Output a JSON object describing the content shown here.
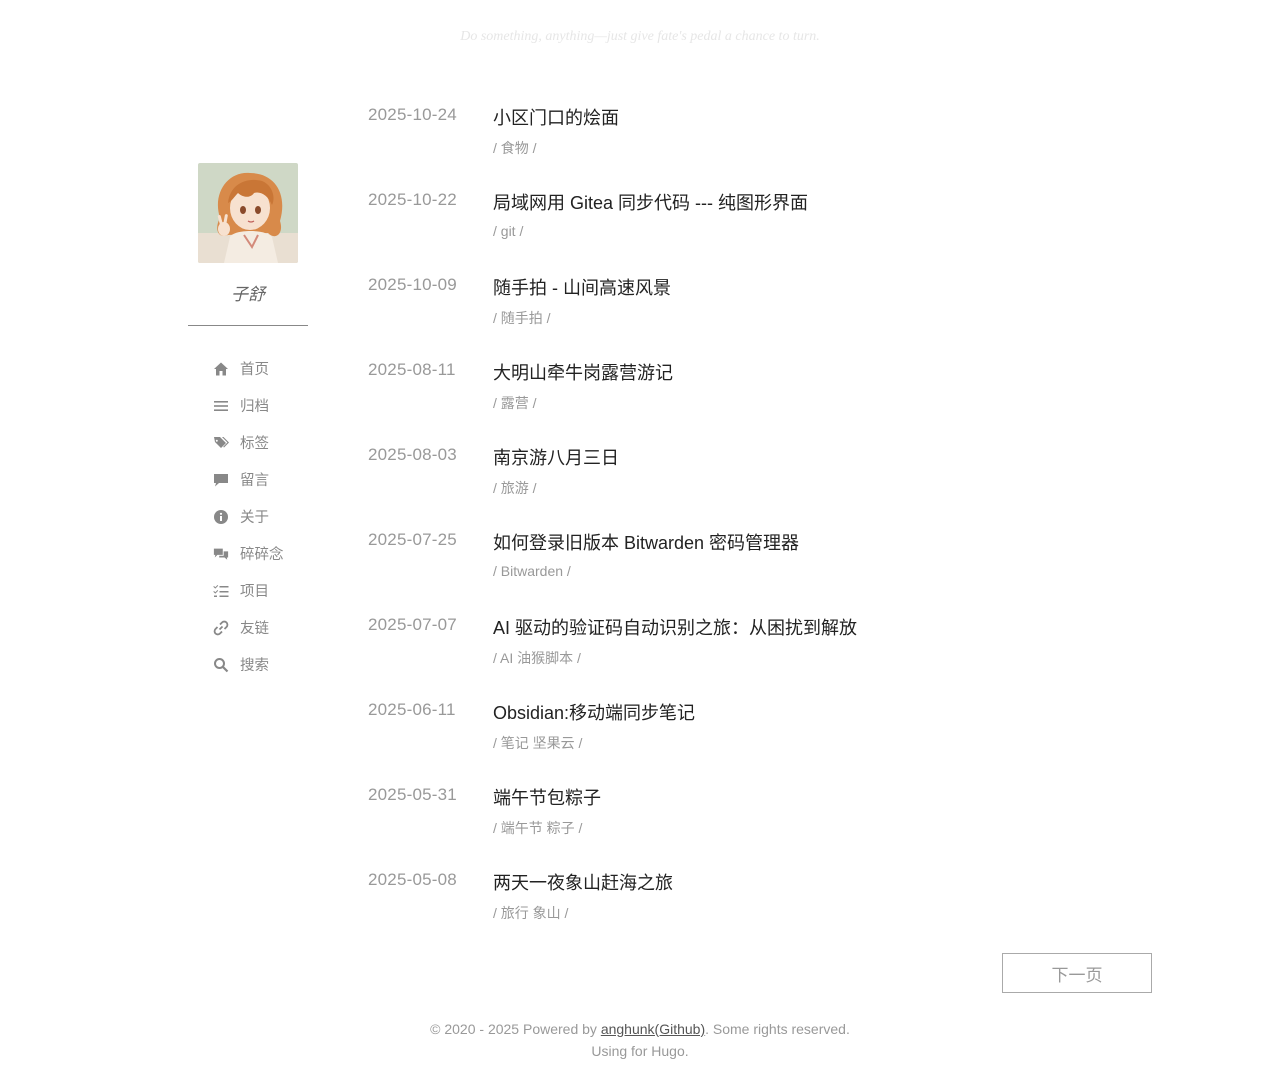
{
  "header": {
    "motto": "Do something, anything—just give fate's pedal a chance to turn."
  },
  "sidebar": {
    "author": "子舒",
    "avatar_icon": "anime-girl-avatar",
    "nav": [
      {
        "label": "首页",
        "icon": "home-icon"
      },
      {
        "label": "归档",
        "icon": "list-icon"
      },
      {
        "label": "标签",
        "icon": "tags-icon"
      },
      {
        "label": "留言",
        "icon": "comment-icon"
      },
      {
        "label": "关于",
        "icon": "info-icon"
      },
      {
        "label": "碎碎念",
        "icon": "comments-icon"
      },
      {
        "label": "项目",
        "icon": "tasks-icon"
      },
      {
        "label": "友链",
        "icon": "link-icon"
      },
      {
        "label": "搜索",
        "icon": "search-icon"
      }
    ]
  },
  "posts": [
    {
      "date": "2025-10-24",
      "title": "小区门口的烩面",
      "tags": [
        "食物"
      ]
    },
    {
      "date": "2025-10-22",
      "title": "局域网用 Gitea 同步代码 --- 纯图形界面",
      "tags": [
        "git"
      ]
    },
    {
      "date": "2025-10-09",
      "title": "随手拍 - 山间高速风景",
      "tags": [
        "随手拍"
      ]
    },
    {
      "date": "2025-08-11",
      "title": "大明山牵牛岗露营游记",
      "tags": [
        "露营"
      ]
    },
    {
      "date": "2025-08-03",
      "title": "南京游八月三日",
      "tags": [
        "旅游"
      ]
    },
    {
      "date": "2025-07-25",
      "title": "如何登录旧版本 Bitwarden 密码管理器",
      "tags": [
        "Bitwarden"
      ]
    },
    {
      "date": "2025-07-07",
      "title": "AI 驱动的验证码自动识别之旅：从困扰到解放",
      "tags": [
        "AI",
        "油猴脚本"
      ]
    },
    {
      "date": "2025-06-11",
      "title": "Obsidian:移动端同步笔记",
      "tags": [
        "笔记",
        "坚果云"
      ]
    },
    {
      "date": "2025-05-31",
      "title": "端午节包粽子",
      "tags": [
        "端午节",
        "粽子"
      ]
    },
    {
      "date": "2025-05-08",
      "title": "两天一夜象山赶海之旅",
      "tags": [
        "旅行",
        "象山"
      ]
    }
  ],
  "pagination": {
    "next_label": "下一页"
  },
  "footer": {
    "copyright_prefix": "© 2020 - 2025 Powered by ",
    "author_link": "anghunk",
    "github_link": "(Github)",
    "copyright_suffix": ". Some rights reserved.",
    "using_prefix": "Using for ",
    "hugo_link": "Hugo",
    "using_suffix": "."
  }
}
